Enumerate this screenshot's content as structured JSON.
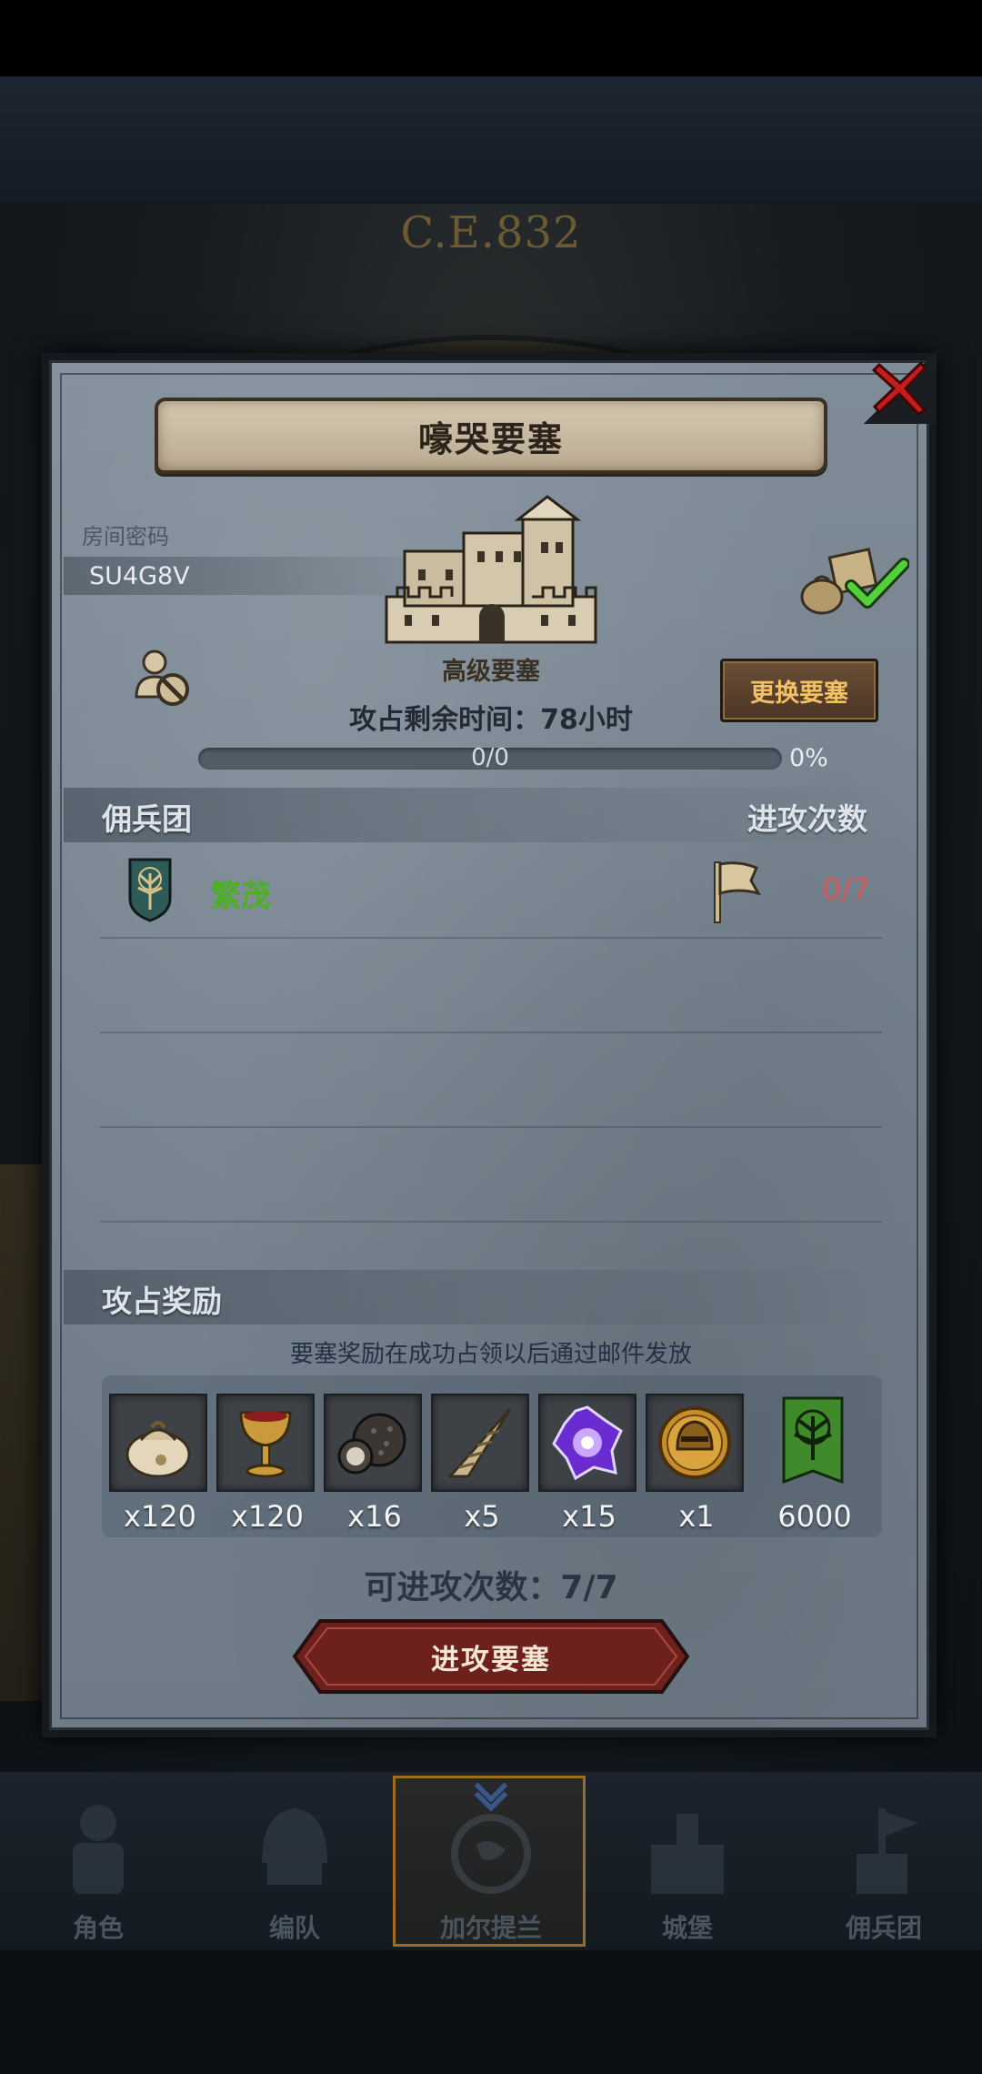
{
  "background": {
    "year_text": "C.E.832"
  },
  "dialog": {
    "title": "嚎哭要塞",
    "room_label": "房间密码",
    "room_code": "SU4G8V",
    "fortress_tier": "高级要塞",
    "timer_text": "攻占剩余时间：78小时",
    "change_button": "更换要塞",
    "progress": {
      "text": "0/0",
      "percent_text": "0%",
      "value": 0
    }
  },
  "mercenary": {
    "header_left": "佣兵团",
    "header_right": "进攻次数",
    "rows": [
      {
        "name": "繁茂",
        "count": "0/7",
        "icon": "tree-shield-icon"
      }
    ]
  },
  "rewards": {
    "header": "攻占奖励",
    "note": "要塞奖励在成功占领以后通过邮件发放",
    "items": [
      {
        "icon": "sack-icon",
        "qty": "x120"
      },
      {
        "icon": "goblet-icon",
        "qty": "x120"
      },
      {
        "icon": "truffle-icon",
        "qty": "x16"
      },
      {
        "icon": "horn-icon",
        "qty": "x5"
      },
      {
        "icon": "crystal-icon",
        "qty": "x15"
      },
      {
        "icon": "helmet-coin-icon",
        "qty": "x1"
      },
      {
        "icon": "tree-banner-icon",
        "qty": "6000"
      }
    ]
  },
  "attempts_text": "可进攻次数：7/7",
  "attack_button": "进攻要塞",
  "nav": {
    "items": [
      {
        "label": "角色"
      },
      {
        "label": "编队"
      },
      {
        "label": "加尔提兰"
      },
      {
        "label": "城堡"
      },
      {
        "label": "佣兵团"
      }
    ],
    "active_index": 2
  },
  "colors": {
    "panel": "#7a8793",
    "accent_gold": "#f1c067",
    "merc_green": "#4caf24",
    "count_red": "#d6595a",
    "attack_red": "#7a2320"
  }
}
